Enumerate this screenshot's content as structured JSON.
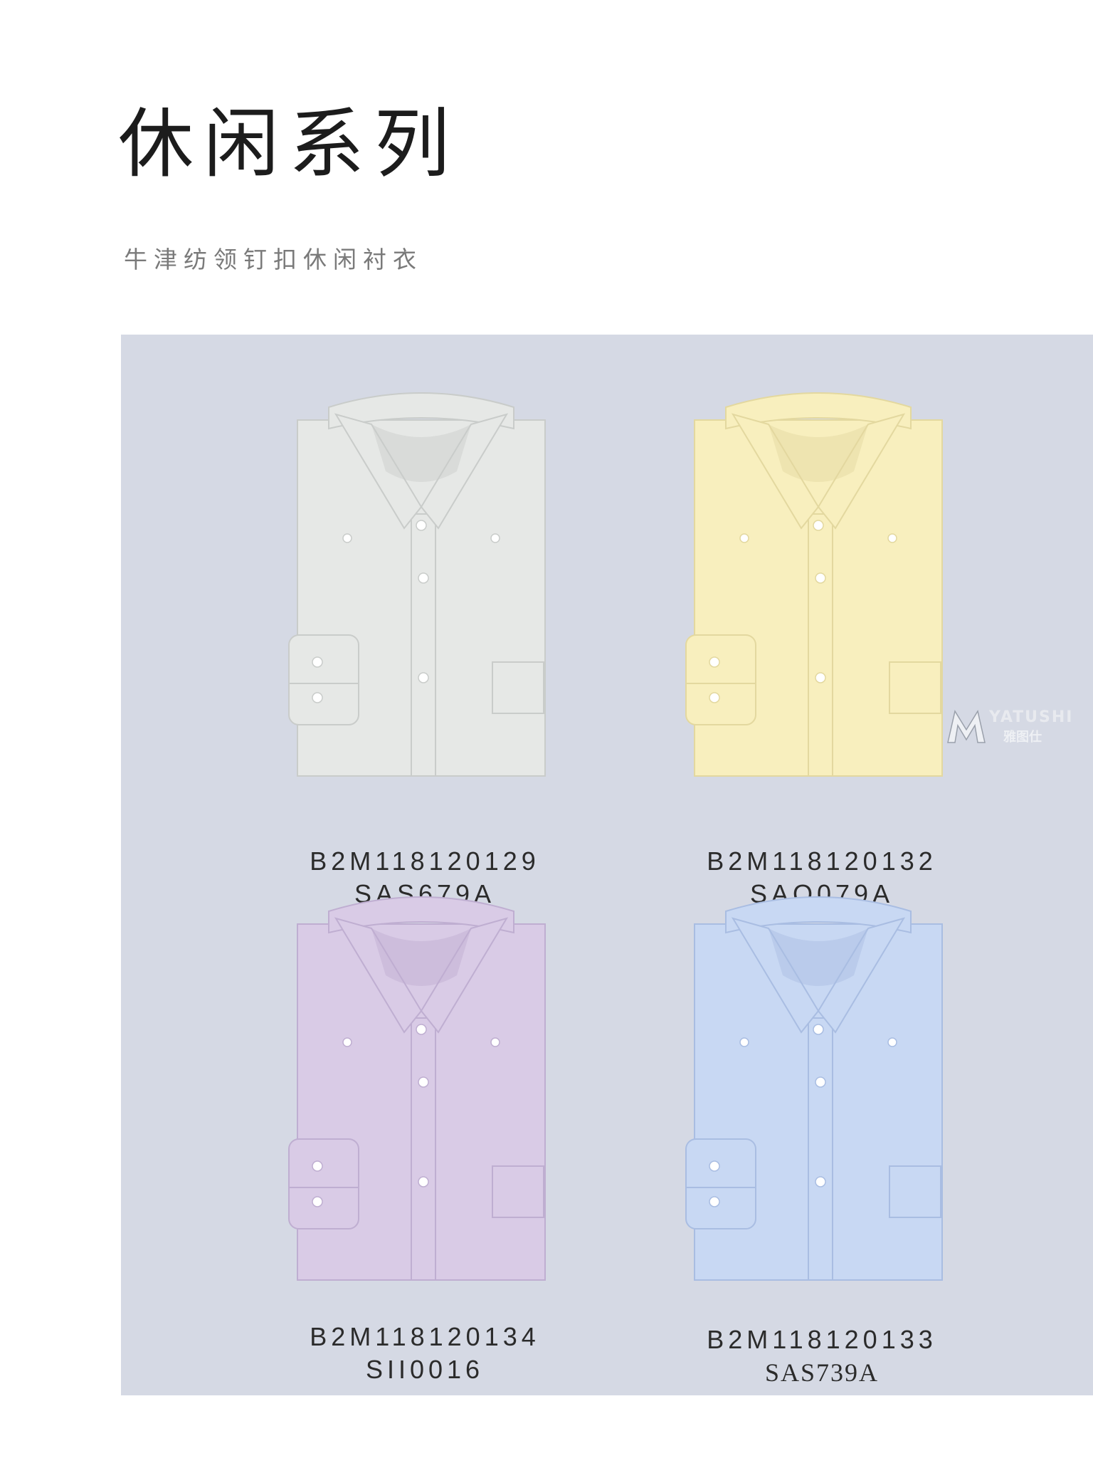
{
  "header": {
    "title": "休闲系列",
    "subtitle": "牛津纺领钉扣休闲衬衣"
  },
  "products": [
    {
      "code": "B2M118120129",
      "style": "SAS679A",
      "color": "#e6e8e6",
      "shade": "#c9ccca"
    },
    {
      "code": "B2M118120132",
      "style": "SAQ079A",
      "color": "#f8efbe",
      "shade": "#e3d89f"
    },
    {
      "code": "B2M118120134",
      "style": "SII0016",
      "color": "#d9cbe6",
      "shade": "#bfaed1"
    },
    {
      "code": "B2M118120133",
      "style": "SAS739A",
      "color": "#c8d8f3",
      "shade": "#a9bde2"
    }
  ],
  "watermark": {
    "line1": "YATUSHI",
    "line2": "雅图仕"
  }
}
